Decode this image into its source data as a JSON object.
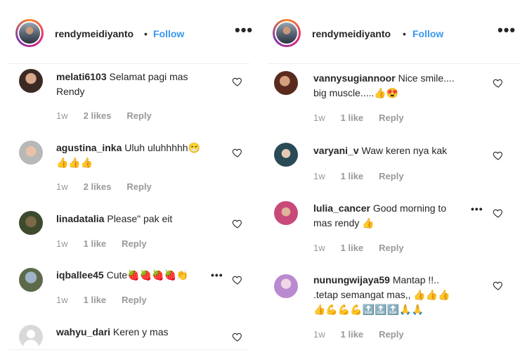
{
  "left": {
    "header": {
      "username": "rendymeidiyanto",
      "dot": "•",
      "follow": "Follow",
      "more": "•••"
    },
    "comments": [
      {
        "user": "melati6103",
        "text": "Selamat pagi mas\nRendy",
        "age": "1w",
        "likes": "2 likes",
        "reply": "Reply"
      },
      {
        "user": "agustina_inka",
        "text": "Uluh uluhhhhh😁\n👍👍👍",
        "age": "1w",
        "likes": "2 likes",
        "reply": "Reply"
      },
      {
        "user": "linadatalia",
        "text": "Please\" pak eit",
        "age": "1w",
        "likes": "1 like",
        "reply": "Reply"
      },
      {
        "user": "iqballee45",
        "text": "Cute🍓🍓🍓🍓👏",
        "age": "1w",
        "likes": "1 like",
        "reply": "Reply"
      },
      {
        "user": "wahyu_dari",
        "text": "Keren y mas",
        "age": "",
        "likes": "",
        "reply": ""
      }
    ],
    "more_dots": "•••"
  },
  "right": {
    "header": {
      "username": "rendymeidiyanto",
      "dot": "•",
      "follow": "Follow",
      "more": "•••"
    },
    "comments": [
      {
        "user": "vannysugiannoor",
        "text": "Nice smile....\nbig muscle.....👍😍",
        "age": "1w",
        "likes": "1 like",
        "reply": "Reply"
      },
      {
        "user": "varyani_v",
        "text": "Waw keren nya kak",
        "age": "1w",
        "likes": "1 like",
        "reply": "Reply"
      },
      {
        "user": "lulia_cancer",
        "text": "Good morning to\nmas rendy 👍",
        "age": "1w",
        "likes": "1 like",
        "reply": "Reply"
      },
      {
        "user": "nunungwijaya59",
        "text": "Mantap !!..\n.tetap semangat mas,, 👍👍👍\n👍💪💪💪🔝🔝🔝🙏🙏",
        "age": "1w",
        "likes": "1 like",
        "reply": "Reply"
      }
    ],
    "more_dots": "•••"
  },
  "colors": {
    "follow": "#3897f0",
    "meta": "#999999",
    "text": "#262626"
  }
}
